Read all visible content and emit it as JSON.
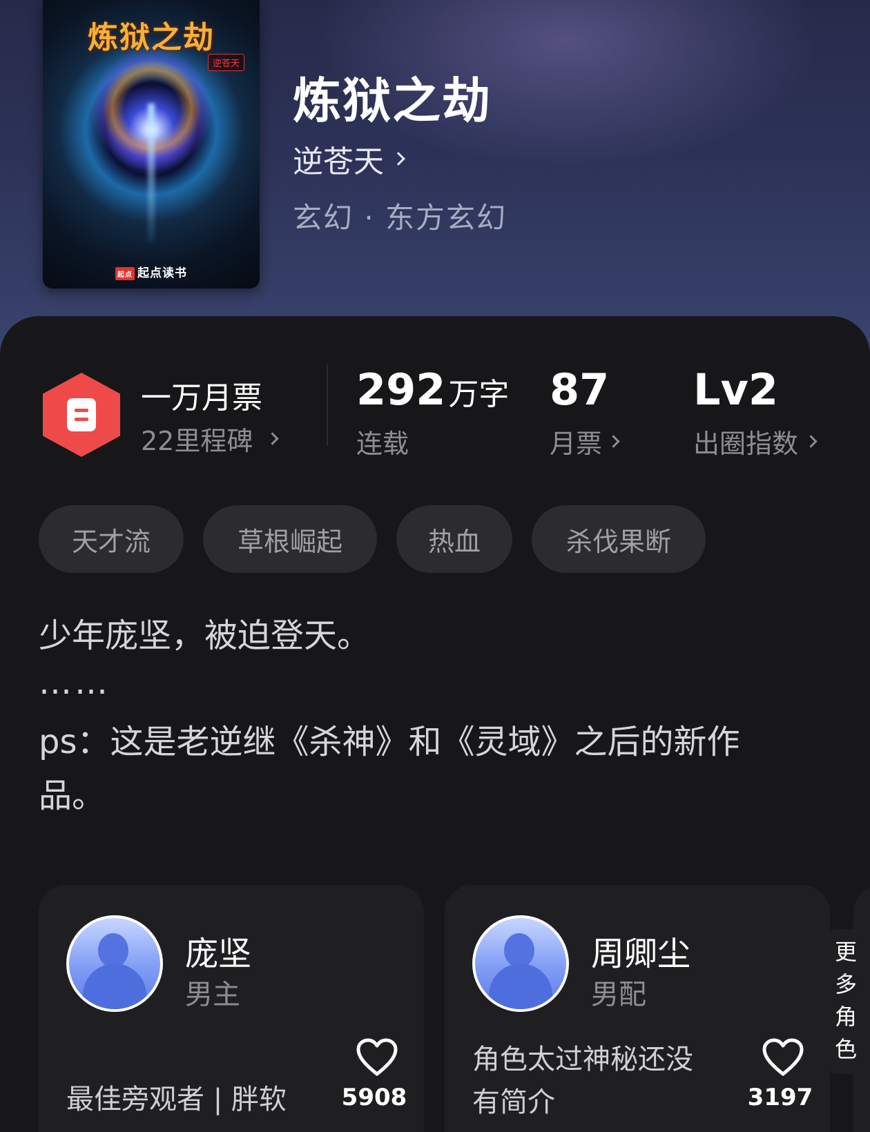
{
  "book": {
    "title": "炼狱之劫",
    "author": "逆苍天",
    "genre": "玄幻 · 东方玄幻",
    "cover": {
      "title": "炼狱之劫",
      "author": "逆苍天",
      "brand": "起点读书",
      "brand_mark": "起点"
    }
  },
  "stats": {
    "ticket_title": "一万月票",
    "ticket_sub": "22里程碑",
    "words_value": "292",
    "words_unit": "万字",
    "words_label": "连载",
    "monthly_value": "87",
    "monthly_label": "月票",
    "circle_value": "Lv2",
    "circle_label": "出圈指数"
  },
  "tags": [
    "天才流",
    "草根崛起",
    "热血",
    "杀伐果断"
  ],
  "description": {
    "line1": "少年庞坚，被迫登天。",
    "line2": "……",
    "line3": "ps：这是老逆继《杀神》和《灵域》之后的新作",
    "line4": "品。"
  },
  "characters": [
    {
      "name": "庞坚",
      "role": "男主",
      "desc": "最佳旁观者 | 胖软",
      "likes": "5908"
    },
    {
      "name": "周卿尘",
      "role": "男配",
      "desc_line1": "角色太过神秘还没",
      "desc_line2": "有简介",
      "likes": "3197"
    }
  ],
  "more_roles": "更多角色",
  "colors": {
    "accent": "#ef4a4a",
    "background": "#171719",
    "card": "#1f1f22",
    "tag_bg": "#2c2c2f"
  }
}
